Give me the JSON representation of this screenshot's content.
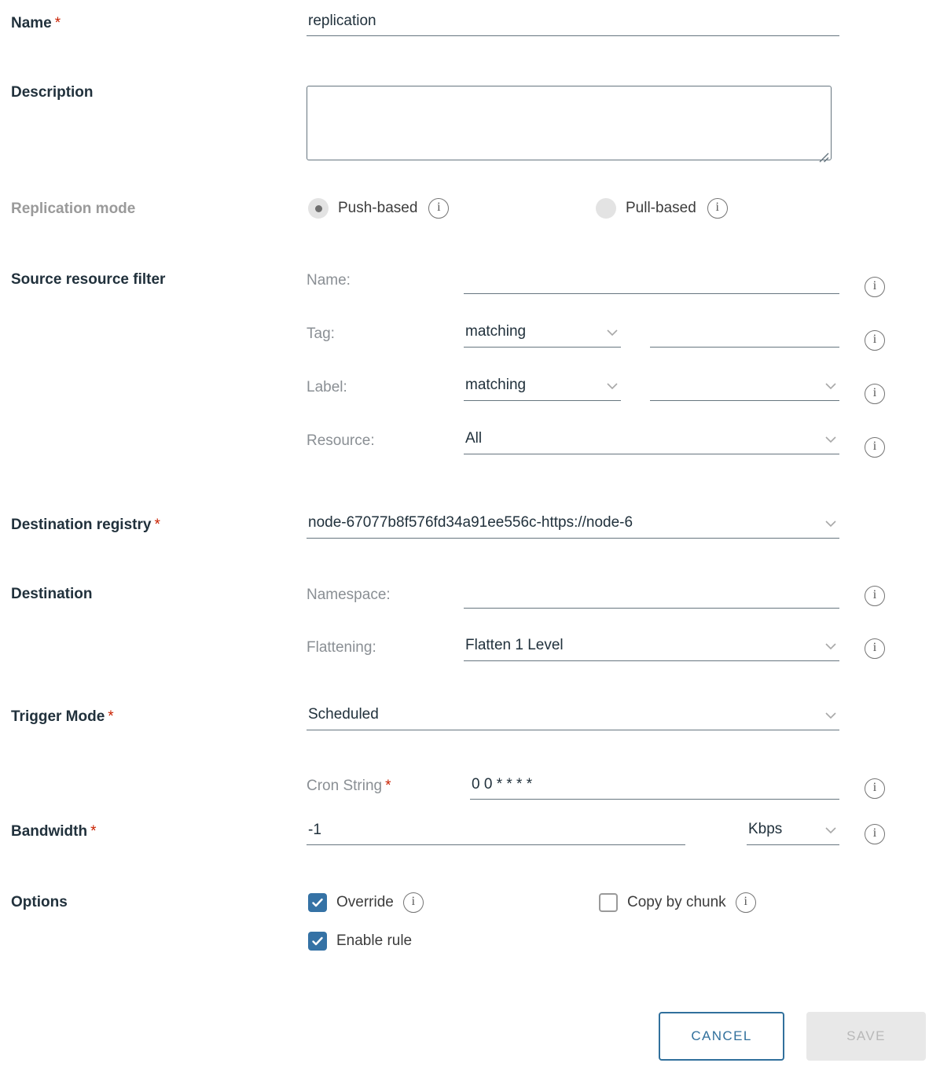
{
  "fields": {
    "name": {
      "label": "Name",
      "required": "*",
      "value": "replication"
    },
    "description": {
      "label": "Description",
      "value": ""
    },
    "replication_mode": {
      "label": "Replication mode",
      "options": [
        {
          "label": "Push-based",
          "selected": true
        },
        {
          "label": "Pull-based",
          "selected": false
        }
      ]
    },
    "source_resource_filter": {
      "label": "Source resource filter",
      "name_row": {
        "label": "Name:",
        "value": ""
      },
      "tag_row": {
        "label": "Tag:",
        "mode": "matching",
        "value": ""
      },
      "label_row": {
        "label": "Label:",
        "mode": "matching",
        "value": ""
      },
      "resource_row": {
        "label": "Resource:",
        "value": "All"
      }
    },
    "destination_registry": {
      "label": "Destination registry",
      "required": "*",
      "value": "node-67077b8f576fd34a91ee556c-https://node-6"
    },
    "destination": {
      "label": "Destination",
      "namespace": {
        "label": "Namespace:",
        "value": ""
      },
      "flattening": {
        "label": "Flattening:",
        "value": "Flatten 1 Level"
      }
    },
    "trigger_mode": {
      "label": "Trigger Mode",
      "required": "*",
      "value": "Scheduled"
    },
    "cron_string": {
      "label": "Cron String",
      "required": "*",
      "value": "0 0 * * * *"
    },
    "bandwidth": {
      "label": "Bandwidth",
      "required": "*",
      "value": "-1",
      "unit": "Kbps"
    },
    "options": {
      "label": "Options",
      "override": {
        "label": "Override",
        "checked": true
      },
      "enable_rule": {
        "label": "Enable rule",
        "checked": true
      },
      "copy_by_chunk": {
        "label": "Copy by chunk",
        "checked": false
      }
    }
  },
  "footer": {
    "cancel_label": "CANCEL",
    "save_label": "SAVE"
  },
  "colors": {
    "accent_blue": "#31709c",
    "checkbox_blue": "#3572a5",
    "required_red": "#c92100",
    "underline_gray": "#66757f",
    "sub_label_gray": "#8a8f94"
  }
}
